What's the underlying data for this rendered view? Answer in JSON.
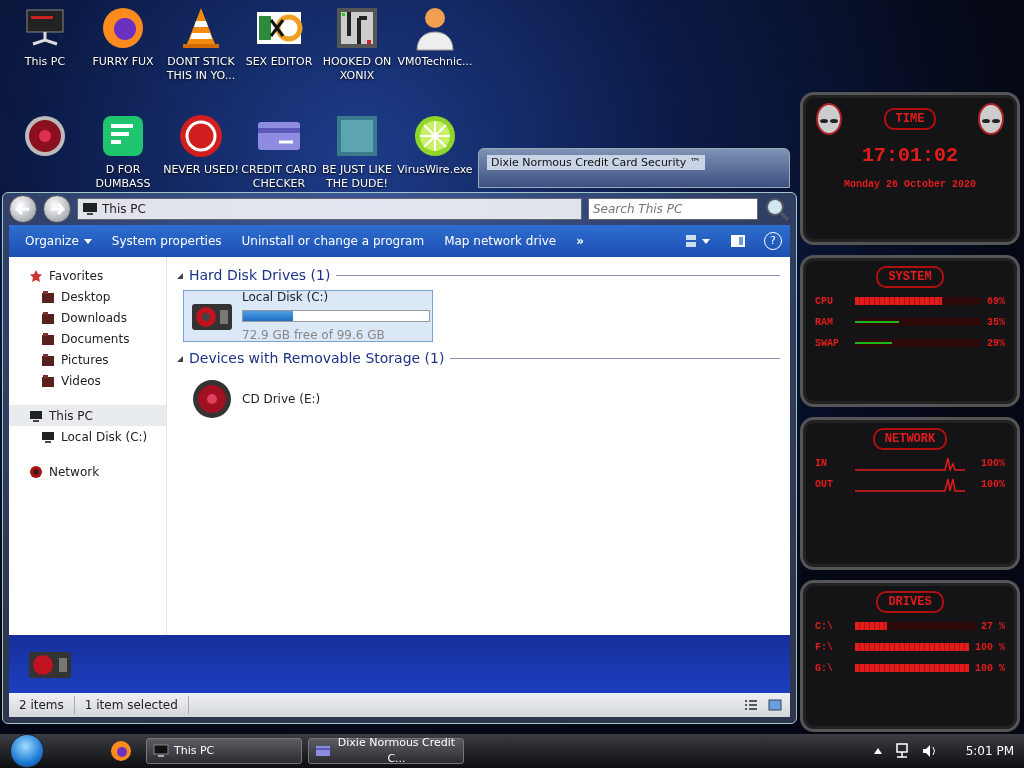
{
  "desktop_icons": [
    {
      "label": "This PC"
    },
    {
      "label": "FURRY FUX"
    },
    {
      "label": "DONT STICK THIS IN YO..."
    },
    {
      "label": "SEX EDITOR"
    },
    {
      "label": "HOOKED ON XONIX"
    },
    {
      "label": "VM0Technic..."
    },
    {
      "label": "D FOR DUMBASS"
    },
    {
      "label": "NEVER USED!"
    },
    {
      "label": "CREDIT CARD CHECKER"
    },
    {
      "label": "BE JUST LIKE THE DUDE!"
    },
    {
      "label": "VirusWire.exe"
    }
  ],
  "background_window": {
    "title": "Dixie Normous Credit Card Security ™"
  },
  "explorer": {
    "address": "This PC",
    "search": {
      "placeholder": "Search This PC"
    },
    "toolbar": [
      {
        "label": "Organize",
        "kind": "menu"
      },
      {
        "label": "System properties",
        "kind": "command"
      },
      {
        "label": "Uninstall or change a program",
        "kind": "command"
      },
      {
        "label": "Map network drive",
        "kind": "command"
      }
    ],
    "overflow": "»",
    "help": "?",
    "sidebar": [
      {
        "label": "Favorites",
        "selected": false,
        "children": [
          {
            "label": "Desktop",
            "selected": false
          },
          {
            "label": "Downloads",
            "selected": false
          },
          {
            "label": "Documents",
            "selected": false
          },
          {
            "label": "Pictures",
            "selected": false
          },
          {
            "label": "Videos",
            "selected": false
          }
        ]
      },
      {
        "label": "This PC",
        "selected": true,
        "children": [
          {
            "label": "Local Disk (C:)",
            "selected": false
          }
        ]
      },
      {
        "label": "Network",
        "selected": false
      }
    ],
    "groups": [
      {
        "title": "Hard Disk Drives (1)",
        "items": [
          {
            "kind": "disk",
            "name": "Local Disk (C:)",
            "level": 0.27,
            "free": "72.9 GB free of 99.6 GB",
            "selected": true
          }
        ]
      },
      {
        "title": "Devices with Removable Storage (1)",
        "items": [
          {
            "kind": "optical",
            "name": "CD Drive (E:)",
            "selected": false
          }
        ]
      }
    ],
    "status_bar": [
      "2 items",
      "1 item selected"
    ]
  },
  "gadget": [
    {
      "kind": "clock",
      "title": "TIME",
      "clock": "17:01:02",
      "date": "Monday 26 October 2020"
    },
    {
      "kind": "meters",
      "title": "SYSTEM",
      "rows": [
        {
          "label": "CPU",
          "level": 0.69,
          "reading": "69%"
        },
        {
          "label": "RAM",
          "level": 0.35,
          "reading": "35%"
        },
        {
          "label": "SWAP",
          "level": 0.29,
          "reading": "29%"
        }
      ]
    },
    {
      "kind": "graphs",
      "title": "NETWORK",
      "rows": [
        {
          "label": "IN",
          "reading": "100%"
        },
        {
          "label": "OUT",
          "reading": "100%"
        }
      ]
    },
    {
      "kind": "drives",
      "title": "DRIVES",
      "rows": [
        {
          "label": "C:\\",
          "level": 0.27,
          "reading": "27 %"
        },
        {
          "label": "F:\\",
          "level": 1,
          "reading": "100 %"
        },
        {
          "label": "G:\\",
          "level": 1,
          "reading": "100 %"
        }
      ]
    }
  ],
  "taskbar": {
    "buttons": [
      {
        "label": "This PC"
      },
      {
        "label": "Dixie Normous Credit C..."
      }
    ],
    "clock": "5:01 PM"
  }
}
